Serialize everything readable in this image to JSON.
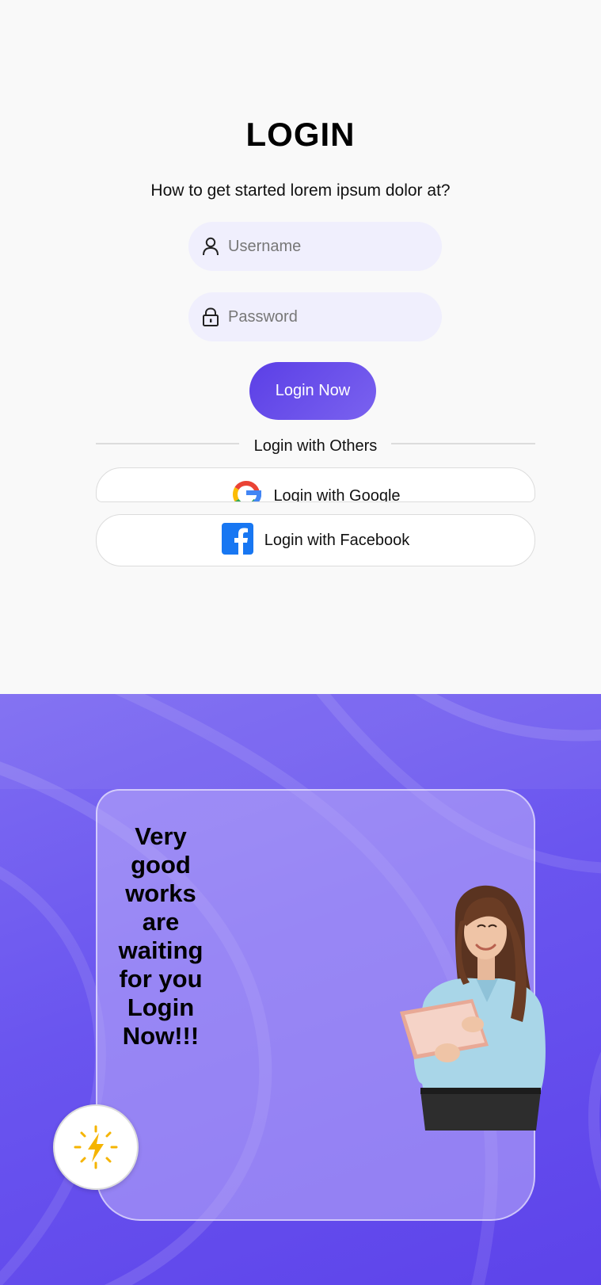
{
  "login": {
    "title": "LOGIN",
    "subtitle": "How to get started lorem ipsum dolor at?",
    "username": {
      "placeholder": "Username",
      "icon": "user-icon"
    },
    "password": {
      "placeholder": "Password",
      "icon": "lock-icon"
    },
    "submit_label": "Login Now",
    "divider_label": "Login with Others",
    "google_label": "Login with Google",
    "facebook_label": "Login with Facebook"
  },
  "promo": {
    "card_text": "Very good works are waiting for you Login Now!!!",
    "badge_icon": "lightning-sun-icon",
    "image": "woman-with-tablet"
  },
  "colors": {
    "accent": "#5b3fe6",
    "accent_light": "#7a62ef",
    "field_bg": "#f0effd",
    "page_bg": "#f9f9f9",
    "facebook_blue": "#1877f2",
    "badge_yellow": "#f5b400"
  }
}
